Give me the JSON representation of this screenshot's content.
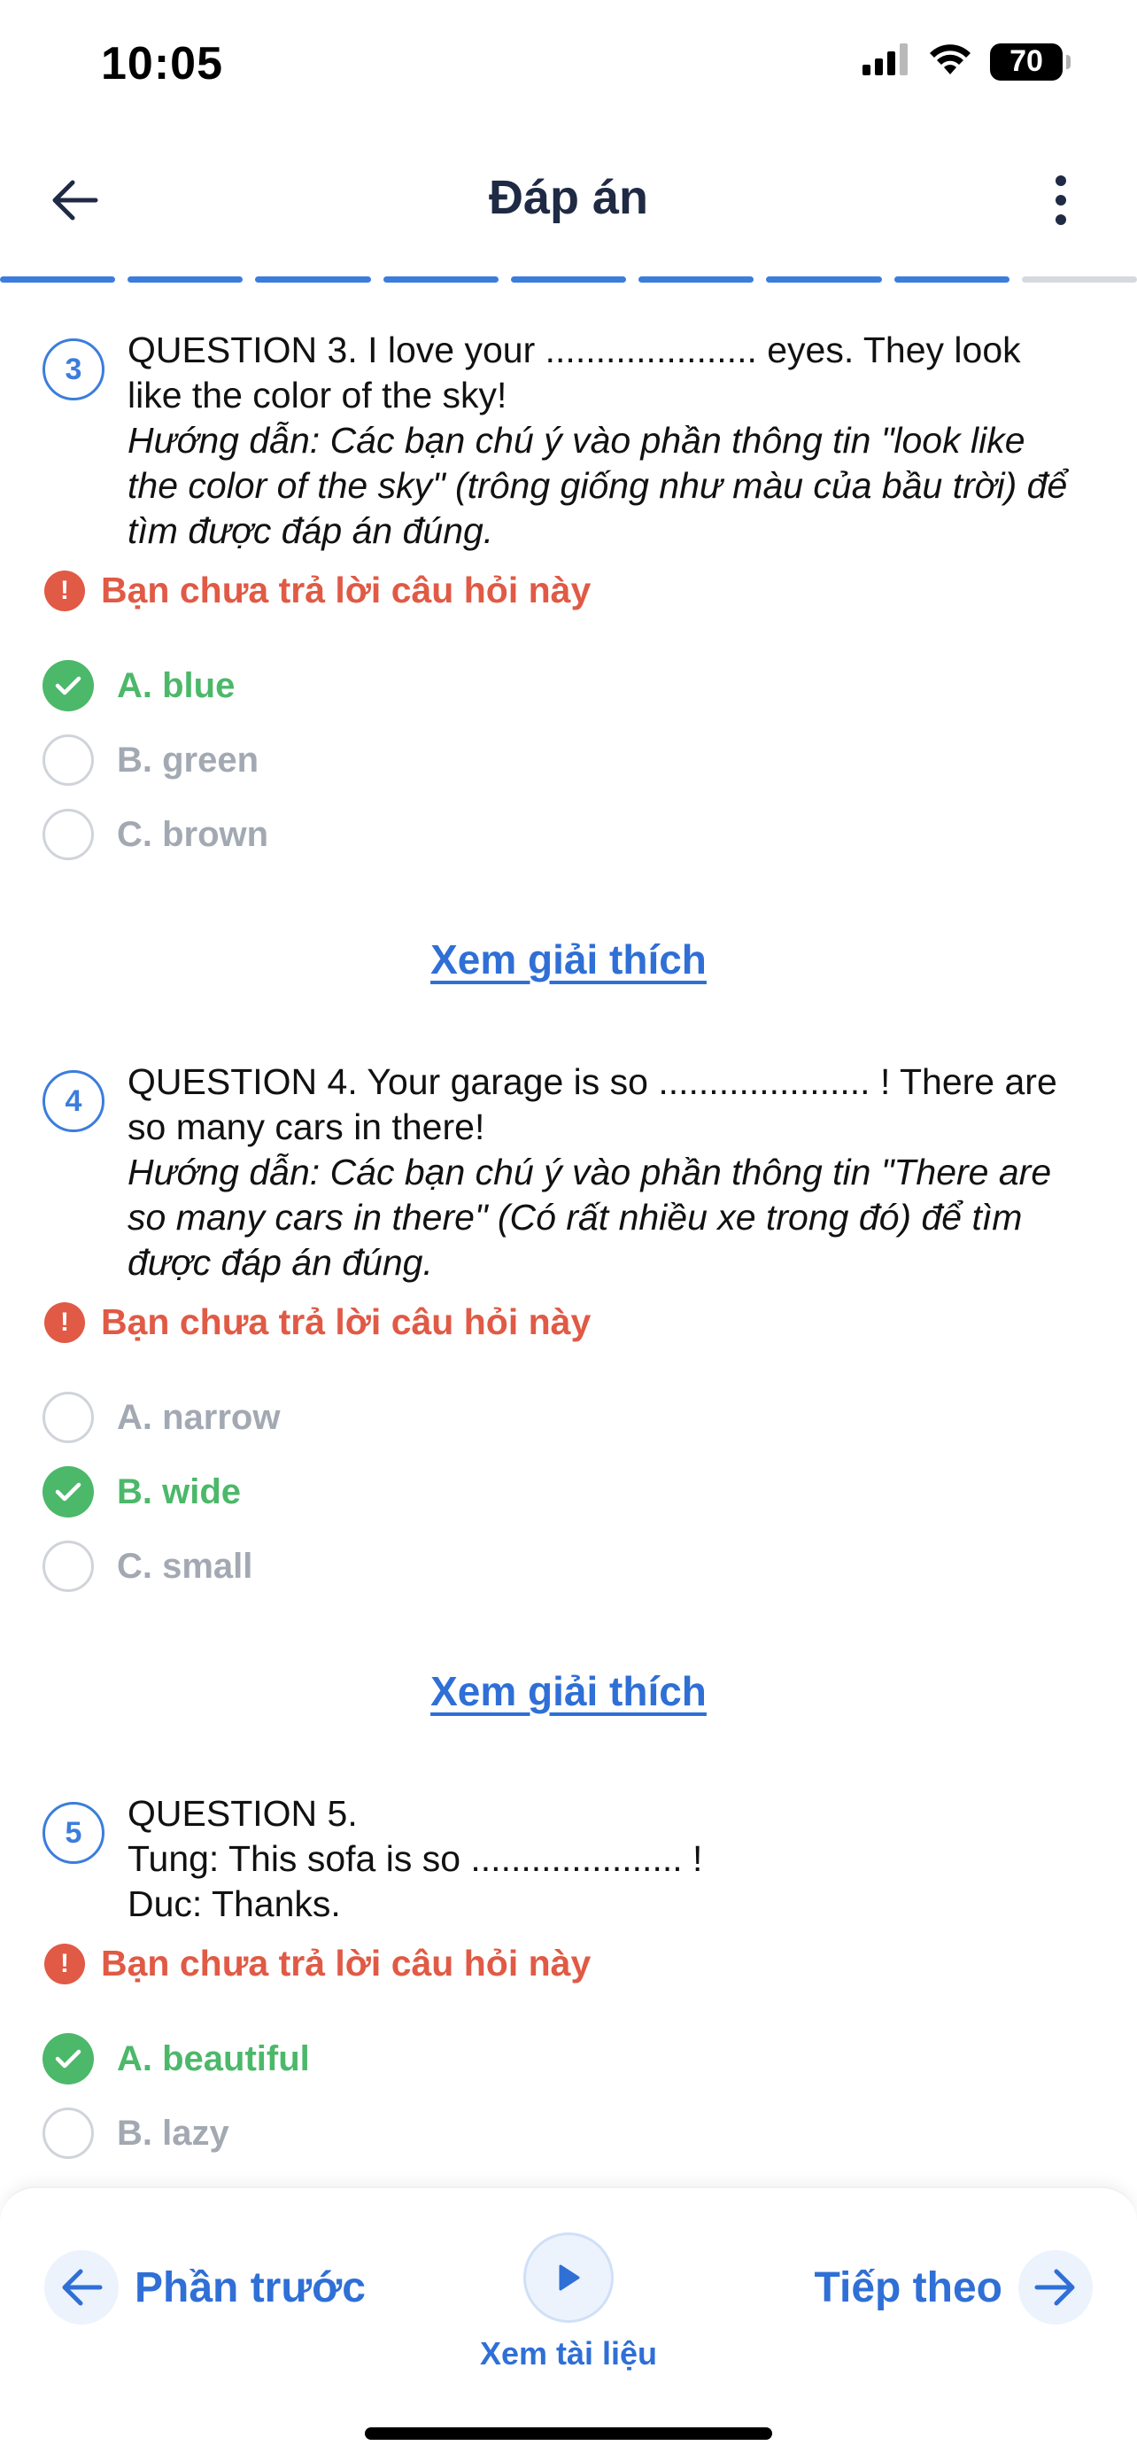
{
  "status": {
    "time": "10:05",
    "battery": "70"
  },
  "header": {
    "title": "Đáp án"
  },
  "progress": {
    "completed_segments": 8,
    "total_segments": 9
  },
  "questions": [
    {
      "number": "3",
      "lines": [
        "QUESTION 3. I love your ..................... eyes. They look like the color of the sky!"
      ],
      "hint": "Hướng dẫn: Các bạn chú ý vào phần thông tin \"look like the color of the sky\" (trông giống như màu của bầu trời) để tìm được đáp án đúng.",
      "warning": "Bạn chưa trả lời câu hỏi này",
      "options": [
        {
          "label": "A. blue",
          "correct": true
        },
        {
          "label": "B. green",
          "correct": false
        },
        {
          "label": "C. brown",
          "correct": false
        }
      ],
      "explain": "Xem giải thích"
    },
    {
      "number": "4",
      "lines": [
        "QUESTION 4. Your garage is so ..................... ! There are so many cars in there!"
      ],
      "hint": "Hướng dẫn: Các bạn chú ý vào phần thông tin \"There are so many cars in there\" (Có rất nhiều xe trong đó) để tìm được đáp án đúng.",
      "warning": "Bạn chưa trả lời câu hỏi này",
      "options": [
        {
          "label": "A. narrow",
          "correct": false
        },
        {
          "label": "B. wide",
          "correct": true
        },
        {
          "label": "C. small",
          "correct": false
        }
      ],
      "explain": "Xem giải thích"
    },
    {
      "number": "5",
      "lines": [
        "QUESTION 5.",
        "Tung: This sofa is so ..................... !",
        "Duc: Thanks."
      ],
      "hint": "",
      "warning": "Bạn chưa trả lời câu hỏi này",
      "options": [
        {
          "label": "A. beautiful",
          "correct": true
        },
        {
          "label": "B. lazy",
          "correct": false
        }
      ],
      "explain": ""
    }
  ],
  "bottom": {
    "prev_label": "Phần trước",
    "docs_label": "Xem tài liệu",
    "next_label": "Tiếp theo"
  },
  "colors": {
    "accent": "#3b7ddd",
    "correct": "#4cb86a",
    "warning": "#e05a45",
    "muted": "#a3a9b2"
  },
  "icons": [
    "signal-icon",
    "wifi-icon",
    "battery-icon",
    "back-arrow-icon",
    "more-vertical-icon",
    "exclamation-icon",
    "check-icon",
    "arrow-left-icon",
    "play-icon",
    "arrow-right-icon"
  ]
}
